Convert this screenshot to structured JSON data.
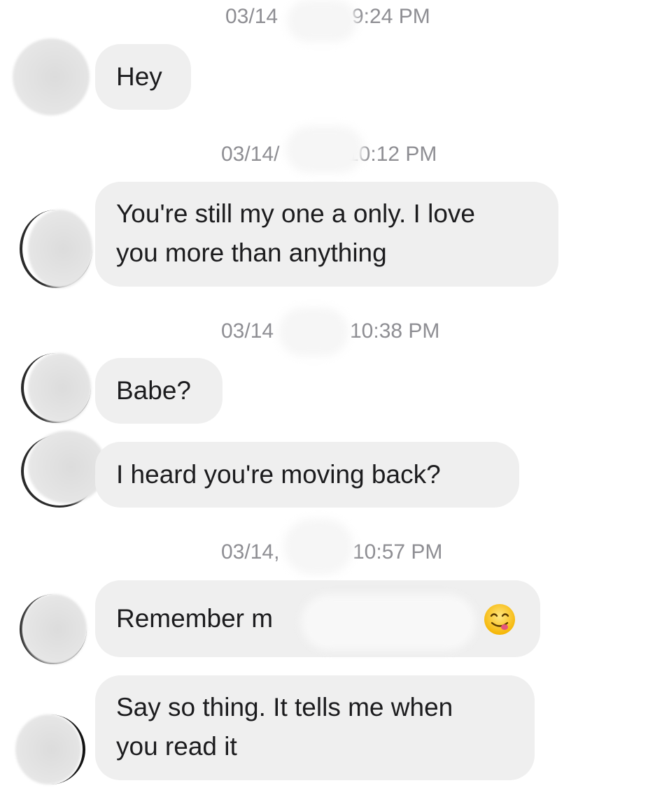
{
  "messages": [
    {
      "timestamp_left": "03/14",
      "timestamp_right": "9:24 PM",
      "bubbles": [
        "Hey"
      ]
    },
    {
      "timestamp_left": "03/14/",
      "timestamp_right": "10:12 PM",
      "bubbles": [
        [
          "You're still my one a only. I love",
          "you more than anything"
        ]
      ]
    },
    {
      "timestamp_left": "03/14",
      "timestamp_right": "10:38 PM",
      "bubbles": [
        "Babe?",
        "I heard you're moving back?"
      ]
    },
    {
      "timestamp_left": "03/14,",
      "timestamp_right": "10:57 PM",
      "bubbles": [
        "Remember m",
        [
          "Say so thing. It tells me when",
          "you read it"
        ]
      ]
    }
  ],
  "emoji": {
    "name": "face-savoring-food-icon",
    "glyph": "😋"
  },
  "colors": {
    "bubble": "#efefef",
    "text": "#1c1c1e",
    "timestamp": "#8e8e93",
    "background": "#ffffff"
  }
}
